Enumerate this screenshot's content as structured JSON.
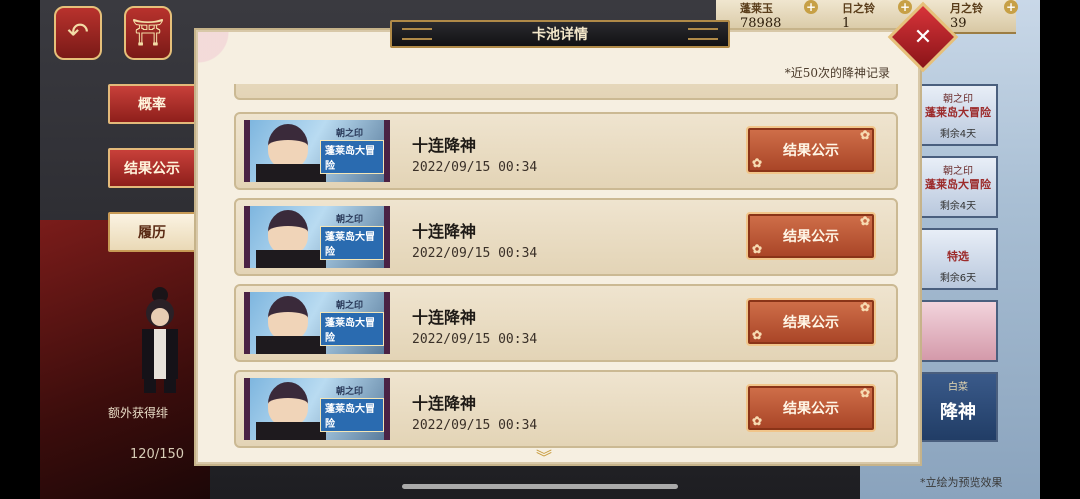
{
  "top": {
    "currencies": [
      {
        "label": "蓬莱玉",
        "value": "78988"
      },
      {
        "label": "日之铃",
        "value": "1"
      },
      {
        "label": "月之铃",
        "value": "39"
      }
    ],
    "back_icon": "back-arrow-icon",
    "home_icon": "shrine-icon"
  },
  "sidebar": {
    "tabs": [
      {
        "label": "概率"
      },
      {
        "label": "结果公示"
      },
      {
        "label": "履历"
      }
    ],
    "character_caption": "额外获得绯",
    "progress_text": "120/150"
  },
  "right_panels": [
    {
      "t1": "朝之印",
      "t2": "蓬莱岛大冒险",
      "t3": "剩余4天"
    },
    {
      "t1": "朝之印",
      "t2": "蓬莱岛大冒险",
      "t3": "剩余4天"
    },
    {
      "t1": "",
      "t2": "特选",
      "t3": "剩余6天"
    },
    {
      "t1": "",
      "t2": "",
      "t3": ""
    },
    {
      "t1": "白菜",
      "t2": "降神",
      "t3": ""
    }
  ],
  "right_footer": "*立绘为预览效果",
  "dialog": {
    "title": "卡池详情",
    "subtitle": "*近50次的降神记录",
    "records": [
      {
        "seal": "朝之印",
        "banner": "蓬莱岛大冒险",
        "title": "十连降神",
        "time": "2022/09/15 00:34",
        "button": "结果公示"
      },
      {
        "seal": "朝之印",
        "banner": "蓬莱岛大冒险",
        "title": "十连降神",
        "time": "2022/09/15 00:34",
        "button": "结果公示"
      },
      {
        "seal": "朝之印",
        "banner": "蓬莱岛大冒险",
        "title": "十连降神",
        "time": "2022/09/15 00:34",
        "button": "结果公示"
      },
      {
        "seal": "朝之印",
        "banner": "蓬莱岛大冒险",
        "title": "十连降神",
        "time": "2022/09/15 00:34",
        "button": "结果公示"
      }
    ],
    "close_icon": "crane-close-icon"
  }
}
